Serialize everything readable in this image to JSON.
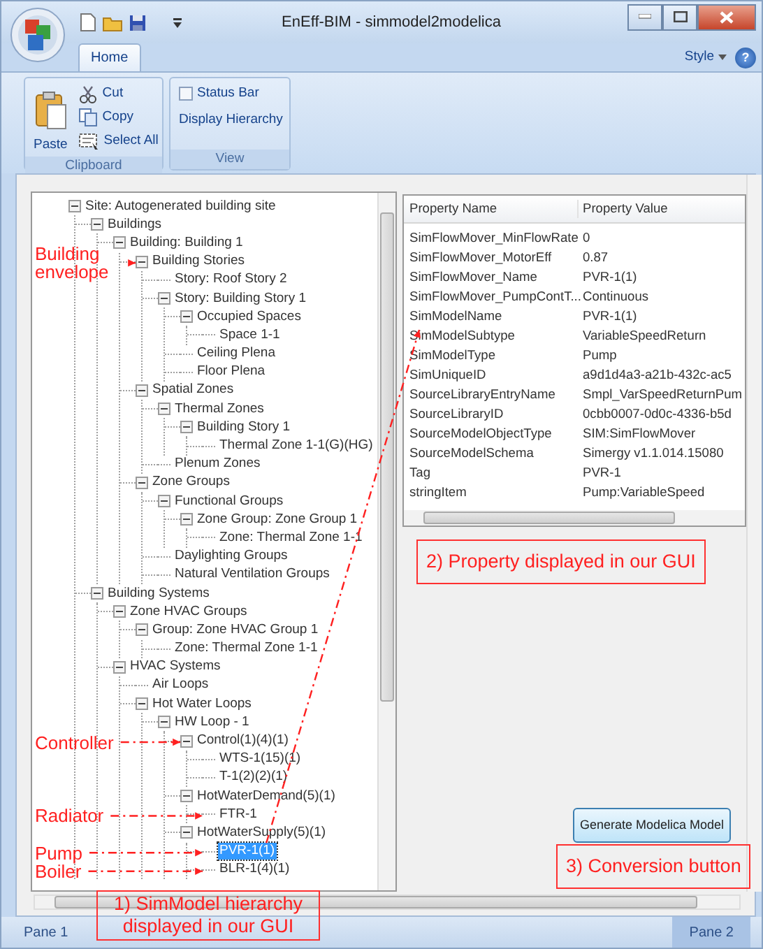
{
  "window": {
    "title": "EnEff-BIM - simmodel2modelica"
  },
  "ribbon": {
    "tabs": [
      {
        "label": "Home",
        "selected": true
      }
    ],
    "style_menu": "Style",
    "help_button": "?",
    "groups": [
      {
        "title": "Clipboard",
        "items": [
          {
            "label": "Paste",
            "kind": "large"
          },
          {
            "label": "Cut",
            "kind": "small"
          },
          {
            "label": "Copy",
            "kind": "small"
          },
          {
            "label": "Select All",
            "kind": "small"
          }
        ]
      },
      {
        "title": "View",
        "items": [
          {
            "label": "Status Bar",
            "kind": "checkbox",
            "checked": false
          },
          {
            "label": "Display Hierarchy",
            "kind": "plain"
          }
        ]
      }
    ]
  },
  "tree": [
    {
      "label": "Site: Autogenerated building site",
      "selected": false,
      "expanded": true,
      "children": [
        {
          "label": "Buildings",
          "selected": false,
          "expanded": true,
          "children": [
            {
              "label": "Building: Building  1",
              "selected": false,
              "expanded": true,
              "children": [
                {
                  "label": "Building Stories",
                  "selected": false,
                  "expanded": true,
                  "callout": "Building envelope",
                  "children": [
                    {
                      "label": "Story: Roof Story  2",
                      "selected": false
                    },
                    {
                      "label": "Story: Building Story  1",
                      "selected": false,
                      "expanded": true,
                      "children": [
                        {
                          "label": "Occupied Spaces",
                          "selected": false,
                          "expanded": true,
                          "children": [
                            {
                              "label": "Space 1-1",
                              "selected": false
                            }
                          ]
                        },
                        {
                          "label": "Ceiling Plena",
                          "selected": false
                        },
                        {
                          "label": "Floor Plena",
                          "selected": false
                        }
                      ]
                    }
                  ]
                },
                {
                  "label": "Spatial Zones",
                  "selected": false,
                  "expanded": true,
                  "children": [
                    {
                      "label": "Thermal Zones",
                      "selected": false,
                      "expanded": true,
                      "children": [
                        {
                          "label": "Building Story  1",
                          "selected": false,
                          "expanded": true,
                          "children": [
                            {
                              "label": "Thermal Zone 1-1(G)(HG)",
                              "selected": false
                            }
                          ]
                        }
                      ]
                    },
                    {
                      "label": "Plenum Zones",
                      "selected": false
                    }
                  ]
                },
                {
                  "label": "Zone Groups",
                  "selected": false,
                  "expanded": true,
                  "children": [
                    {
                      "label": "Functional Groups",
                      "selected": false,
                      "expanded": true,
                      "children": [
                        {
                          "label": "Zone Group: Zone Group 1",
                          "selected": false,
                          "expanded": true,
                          "children": [
                            {
                              "label": "Zone: Thermal Zone 1-1",
                              "selected": false
                            }
                          ]
                        }
                      ]
                    },
                    {
                      "label": "Daylighting Groups",
                      "selected": false
                    },
                    {
                      "label": "Natural Ventilation Groups",
                      "selected": false
                    }
                  ]
                }
              ]
            }
          ]
        },
        {
          "label": "Building Systems",
          "selected": false,
          "expanded": true,
          "children": [
            {
              "label": "Zone HVAC Groups",
              "selected": false,
              "expanded": true,
              "children": [
                {
                  "label": "Group: Zone HVAC Group 1",
                  "selected": false,
                  "expanded": true,
                  "children": [
                    {
                      "label": "Zone: Thermal Zone 1-1",
                      "selected": false
                    }
                  ]
                }
              ]
            },
            {
              "label": "HVAC Systems",
              "selected": false,
              "expanded": true,
              "children": [
                {
                  "label": "Air Loops",
                  "selected": false
                },
                {
                  "label": "Hot Water Loops",
                  "selected": false,
                  "expanded": true,
                  "children": [
                    {
                      "label": "HW Loop - 1",
                      "selected": false,
                      "expanded": true,
                      "children": [
                        {
                          "label": "Control(1)(4)(1)",
                          "selected": false,
                          "expanded": true,
                          "callout": "Controller",
                          "children": [
                            {
                              "label": "WTS-1(15)(1)",
                              "selected": false
                            },
                            {
                              "label": "T-1(2)(2)(1)",
                              "selected": false
                            }
                          ]
                        },
                        {
                          "label": "HotWaterDemand(5)(1)",
                          "selected": false,
                          "expanded": true,
                          "children": [
                            {
                              "label": "FTR-1",
                              "selected": false,
                              "callout": "Radiator"
                            }
                          ]
                        },
                        {
                          "label": "HotWaterSupply(5)(1)",
                          "selected": false,
                          "expanded": true,
                          "children": [
                            {
                              "label": "PVR-1(1)",
                              "selected": true,
                              "callout": "Pump"
                            },
                            {
                              "label": "BLR-1(4)(1)",
                              "selected": false,
                              "callout": "Boiler"
                            }
                          ]
                        }
                      ]
                    }
                  ]
                }
              ]
            }
          ]
        }
      ]
    }
  ],
  "properties": {
    "columns": [
      "Property Name",
      "Property Value"
    ],
    "rows": [
      [
        "SimFlowMover_MinFlowRate",
        "0"
      ],
      [
        "SimFlowMover_MotorEff",
        "0.87"
      ],
      [
        "SimFlowMover_Name",
        "PVR-1(1)"
      ],
      [
        "SimFlowMover_PumpContT...",
        "Continuous"
      ],
      [
        "SimModelName",
        "PVR-1(1)"
      ],
      [
        "SimModelSubtype",
        "VariableSpeedReturn"
      ],
      [
        "SimModelType",
        "Pump"
      ],
      [
        "SimUniqueID",
        "a9d1d4a3-a21b-432c-ac5"
      ],
      [
        "SourceLibraryEntryName",
        "Smpl_VarSpeedReturnPum"
      ],
      [
        "SourceLibraryID",
        "0cbb0007-0d0c-4336-b5d"
      ],
      [
        "SourceModelObjectType",
        "SIM:SimFlowMover"
      ],
      [
        "SourceModelSchema",
        "Simergy v1.1.014.15080"
      ],
      [
        "Tag",
        "PVR-1"
      ],
      [
        "stringItem",
        "Pump:VariableSpeed"
      ]
    ]
  },
  "convert_button": "Generate Modelica Model",
  "annotations": [
    "1) SimModel hierarchy displayed in our GUI",
    "2) Property displayed in our GUI",
    "3) Conversion button"
  ],
  "status_bar": {
    "panes": [
      "Pane 1",
      "Pane 2"
    ]
  }
}
